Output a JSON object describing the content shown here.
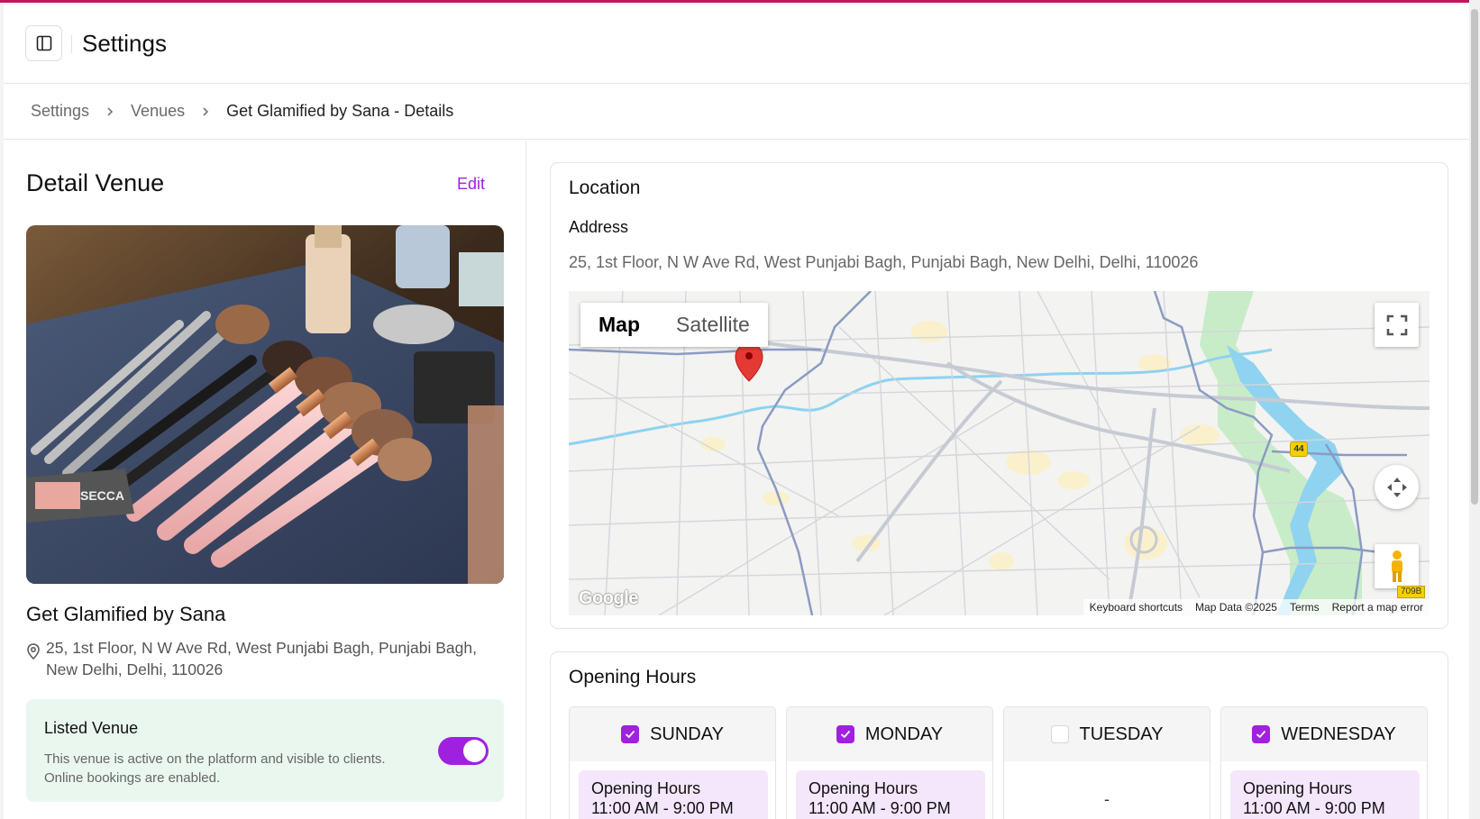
{
  "header": {
    "title": "Settings",
    "toggle_icon": "sidebar-toggle-icon"
  },
  "breadcrumb": [
    {
      "label": "Settings"
    },
    {
      "label": "Venues"
    },
    {
      "label": "Get Glamified by Sana - Details"
    }
  ],
  "venue_panel": {
    "title": "Detail Venue",
    "edit_label": "Edit",
    "name": "Get Glamified by Sana",
    "address": "25, 1st Floor, N W Ave Rd, West Punjabi Bagh, Punjabi Bagh, New Delhi, Delhi, 110026",
    "listed": {
      "title": "Listed Venue",
      "description": "This venue is active on the platform and visible to clients. Online bookings are enabled.",
      "enabled": true
    }
  },
  "location": {
    "title": "Location",
    "address_label": "Address",
    "address_value": "25, 1st Floor, N W Ave Rd, West Punjabi Bagh, Punjabi Bagh, New Delhi, Delhi, 110026",
    "map": {
      "type_options": [
        "Map",
        "Satellite"
      ],
      "selected_type": "Map",
      "logo": "Google",
      "route_shield": "44",
      "road_label": "709B",
      "footer": [
        "Keyboard shortcuts",
        "Map Data ©2025",
        "Terms",
        "Report a map error"
      ]
    }
  },
  "opening_hours": {
    "title": "Opening Hours",
    "days": [
      {
        "name": "SUNDAY",
        "checked": true,
        "label": "Opening Hours",
        "hours": "11:00 AM - 9:00 PM"
      },
      {
        "name": "MONDAY",
        "checked": true,
        "label": "Opening Hours",
        "hours": "11:00 AM - 9:00 PM"
      },
      {
        "name": "TUESDAY",
        "checked": false,
        "closed_text": "-"
      },
      {
        "name": "WEDNESDAY",
        "checked": true,
        "label": "Opening Hours",
        "hours": "11:00 AM - 9:00 PM"
      }
    ]
  },
  "colors": {
    "accent": "#a020e0",
    "top_border": "#c2185b",
    "listed_bg": "#e9f7ef",
    "hours_bg": "#f4e6fb",
    "map_pin": "#e53935"
  }
}
